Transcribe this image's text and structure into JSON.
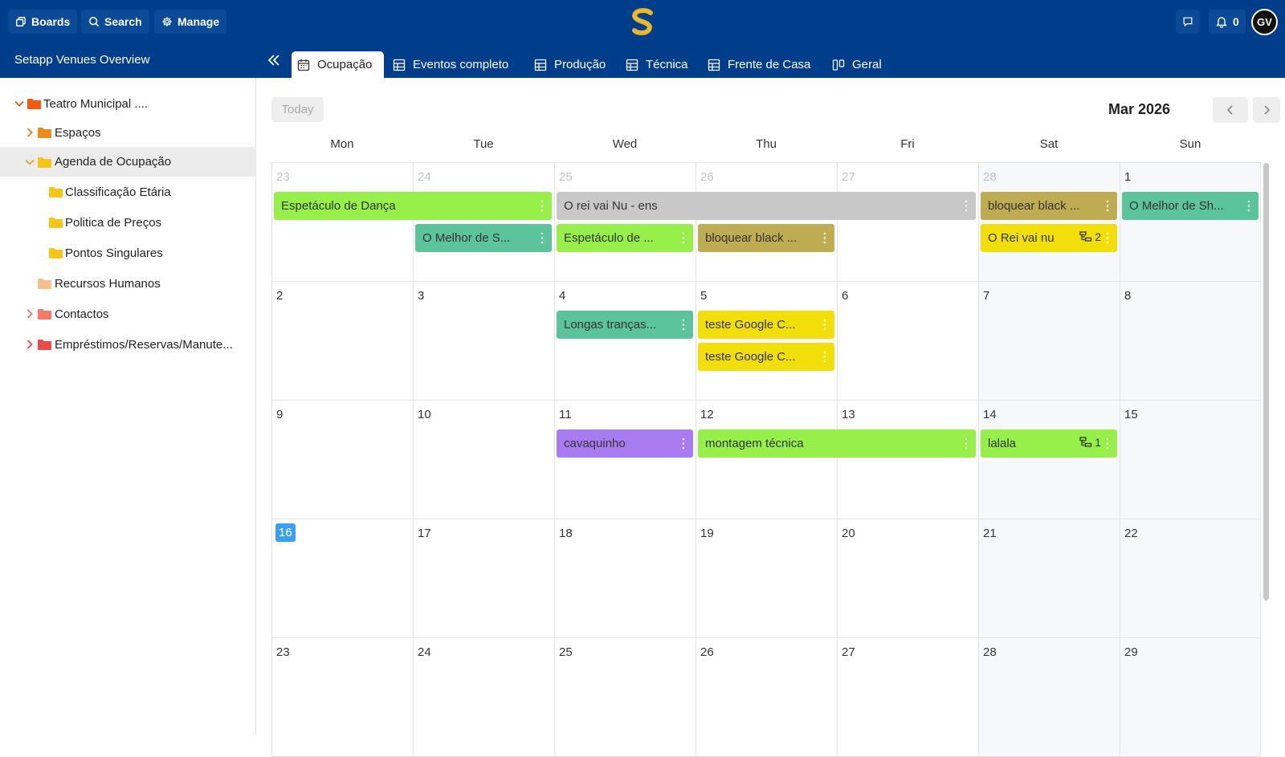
{
  "topbar": {
    "boards_label": "Boards",
    "search_label": "Search",
    "manage_label": "Manage",
    "notifications_count": "0",
    "avatar_initials": "GV",
    "brand_color": "#003e8c"
  },
  "workspace": {
    "title": "Setapp Venues Overview"
  },
  "tabs": [
    {
      "label": "Ocupação",
      "icon": "calendar-icon",
      "active": true
    },
    {
      "label": "Eventos completo",
      "icon": "table-icon"
    },
    {
      "label": "Produção",
      "icon": "table-icon"
    },
    {
      "label": "Técnica",
      "icon": "table-icon"
    },
    {
      "label": "Frente de Casa",
      "icon": "table-icon"
    },
    {
      "label": "Geral",
      "icon": "columns-icon"
    }
  ],
  "sidebar": {
    "items": [
      {
        "label": "Teatro Municipal ....",
        "expanded": true,
        "folder_color": "#f25a0f"
      },
      {
        "label": "Espaços",
        "expanded": false,
        "folder_color": "#f08a1a"
      },
      {
        "label": "Agenda de Ocupação",
        "expanded": true,
        "folder_color": "#f5c518",
        "selected": true
      },
      {
        "label": "Classificação Etária",
        "folder_color": "#f5c518"
      },
      {
        "label": "Politica de Preços",
        "folder_color": "#f5c518"
      },
      {
        "label": "Pontos Singulares",
        "folder_color": "#f5c518"
      },
      {
        "label": "Recursos Humanos",
        "folder_color": "#f7c08a"
      },
      {
        "label": "Contactos",
        "expanded": false,
        "folder_color": "#f47a6a"
      },
      {
        "label": "Empréstimos/Reservas/Manute...",
        "expanded": false,
        "folder_color": "#ec4a4a"
      }
    ]
  },
  "calendar": {
    "today_label": "Today",
    "month_label": "Mar 2026",
    "weekdays": [
      "Mon",
      "Tue",
      "Wed",
      "Thu",
      "Fri",
      "Sat",
      "Sun"
    ],
    "weeks": [
      [
        "23",
        "24",
        "25",
        "26",
        "27",
        "28",
        "1"
      ],
      [
        "2",
        "3",
        "4",
        "5",
        "6",
        "7",
        "8"
      ],
      [
        "9",
        "10",
        "11",
        "12",
        "13",
        "14",
        "15"
      ],
      [
        "16",
        "17",
        "18",
        "19",
        "20",
        "21",
        "22"
      ],
      [
        "23",
        "24",
        "25",
        "26",
        "27",
        "28",
        "29"
      ]
    ],
    "today_cell": {
      "week": 3,
      "day": 0
    },
    "events": [
      {
        "title": "Espetáculo de Dança",
        "week": 0,
        "start": 0,
        "span": 2,
        "lane": 0,
        "color": "#97f04a"
      },
      {
        "title": "O rei vai Nu - ens",
        "week": 0,
        "start": 2,
        "span": 3,
        "lane": 0,
        "color": "#c8c8c8"
      },
      {
        "title": "bloquear black ...",
        "week": 0,
        "start": 5,
        "span": 1,
        "lane": 0,
        "color": "#bfac52"
      },
      {
        "title": "O Melhor de Sh...",
        "week": 0,
        "start": 6,
        "span": 1,
        "lane": 0,
        "color": "#5cc49c"
      },
      {
        "title": "O Melhor de S...",
        "week": 0,
        "start": 1,
        "span": 1,
        "lane": 1,
        "color": "#5cc49c"
      },
      {
        "title": "Espetáculo de ...",
        "week": 0,
        "start": 2,
        "span": 1,
        "lane": 1,
        "color": "#97f04a"
      },
      {
        "title": "bloquear black ...",
        "week": 0,
        "start": 3,
        "span": 1,
        "lane": 1,
        "color": "#bfac52"
      },
      {
        "title": "O Rei vai nu",
        "week": 0,
        "start": 5,
        "span": 1,
        "lane": 1,
        "color": "#f2df0a",
        "subitems": "2"
      },
      {
        "title": "Longas tranças...",
        "week": 1,
        "start": 2,
        "span": 1,
        "lane": 0,
        "color": "#5cc49c"
      },
      {
        "title": "teste Google C...",
        "week": 1,
        "start": 3,
        "span": 1,
        "lane": 0,
        "color": "#f2df0a"
      },
      {
        "title": "teste Google C...",
        "week": 1,
        "start": 3,
        "span": 1,
        "lane": 1,
        "color": "#f2df0a"
      },
      {
        "title": "cavaquinho",
        "week": 2,
        "start": 2,
        "span": 1,
        "lane": 0,
        "color": "#a87cf0"
      },
      {
        "title": "montagem técnica",
        "week": 2,
        "start": 3,
        "span": 2,
        "lane": 0,
        "color": "#97f04a"
      },
      {
        "title": "lalala",
        "week": 2,
        "start": 5,
        "span": 1,
        "lane": 0,
        "color": "#97f04a",
        "subitems": "1"
      }
    ]
  }
}
